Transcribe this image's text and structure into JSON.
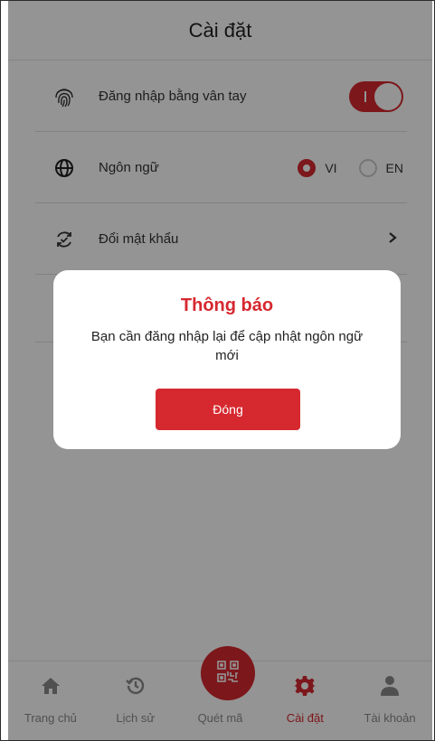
{
  "header": {
    "title": "Cài đặt"
  },
  "settings": {
    "fingerprint": {
      "label": "Đăng nhập bằng vân tay",
      "enabled": true
    },
    "language": {
      "label": "Ngôn ngữ",
      "options": [
        "VI",
        "EN"
      ],
      "selected": "VI"
    },
    "password": {
      "label": "Đổi mật khẩu"
    }
  },
  "dialog": {
    "title": "Thông báo",
    "message": "Bạn cần đăng nhập lại để cập nhật ngôn ngữ mới",
    "button": "Đóng"
  },
  "bottom_nav": [
    {
      "label": "Trang chủ",
      "icon": "home-icon"
    },
    {
      "label": "Lịch sử",
      "icon": "history-icon"
    },
    {
      "label": "Quét mã",
      "icon": "qr-scan-icon"
    },
    {
      "label": "Cài đặt",
      "icon": "gear-icon",
      "active": true
    },
    {
      "label": "Tài khoản",
      "icon": "user-icon"
    }
  ],
  "colors": {
    "accent": "#d6282f"
  }
}
